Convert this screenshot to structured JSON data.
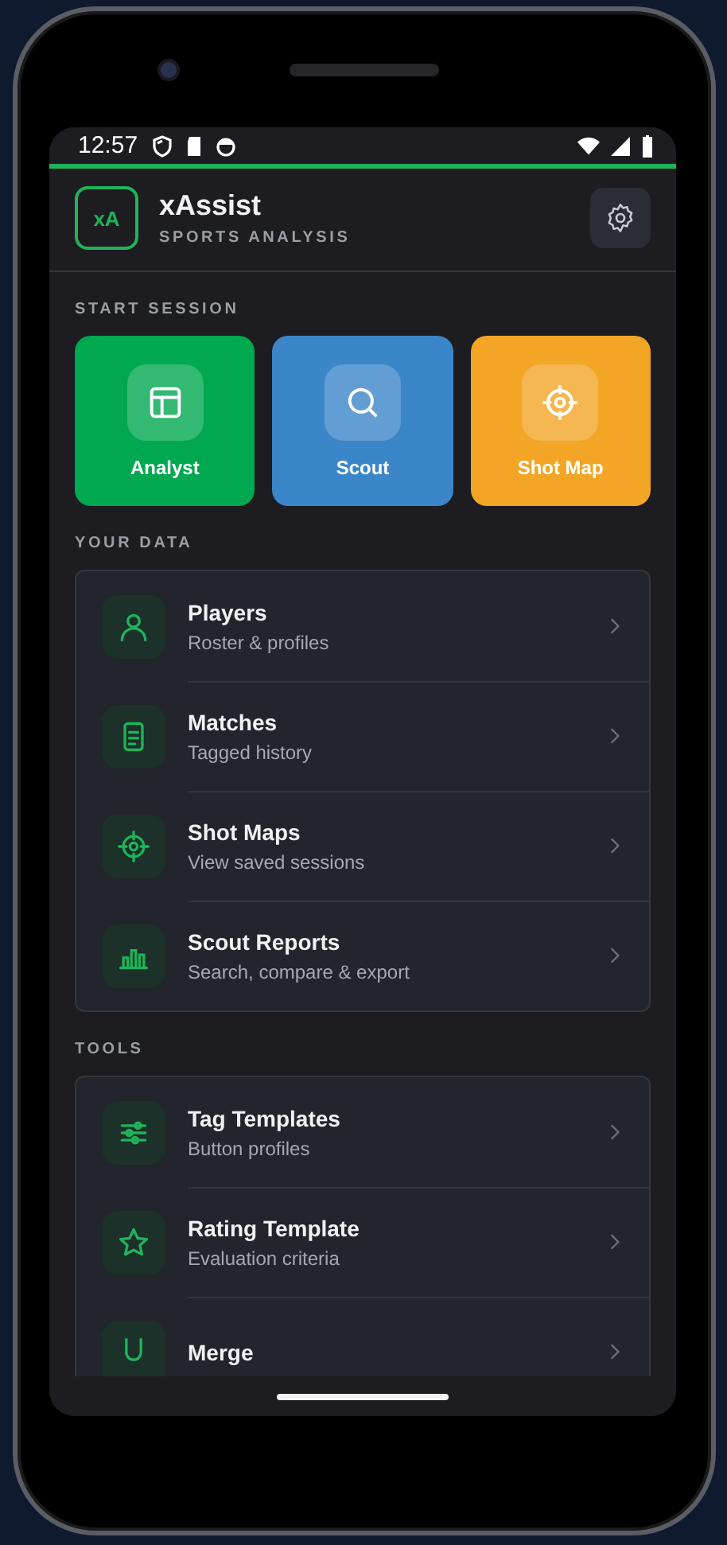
{
  "status_bar": {
    "time": "12:57"
  },
  "header": {
    "logo": "xA",
    "title": "xAssist",
    "subtitle": "SPORTS ANALYSIS"
  },
  "start_session": {
    "label": "START SESSION",
    "tiles": [
      {
        "label": "Analyst",
        "kind": "layout",
        "color": "#00a84f"
      },
      {
        "label": "Scout",
        "kind": "search",
        "color": "#3b86c8"
      },
      {
        "label": "Shot Map",
        "kind": "target",
        "color": "#f3a526"
      }
    ]
  },
  "your_data": {
    "label": "YOUR DATA",
    "items": [
      {
        "title": "Players",
        "subtitle": "Roster & profiles",
        "kind": "person"
      },
      {
        "title": "Matches",
        "subtitle": "Tagged history",
        "kind": "document"
      },
      {
        "title": "Shot Maps",
        "subtitle": "View saved sessions",
        "kind": "target"
      },
      {
        "title": "Scout Reports",
        "subtitle": "Search, compare & export",
        "kind": "bars"
      }
    ]
  },
  "tools": {
    "label": "TOOLS",
    "items": [
      {
        "title": "Tag Templates",
        "subtitle": "Button profiles",
        "kind": "sliders"
      },
      {
        "title": "Rating Template",
        "subtitle": "Evaluation criteria",
        "kind": "star"
      },
      {
        "title": "Merge",
        "kind": "merge"
      }
    ]
  }
}
